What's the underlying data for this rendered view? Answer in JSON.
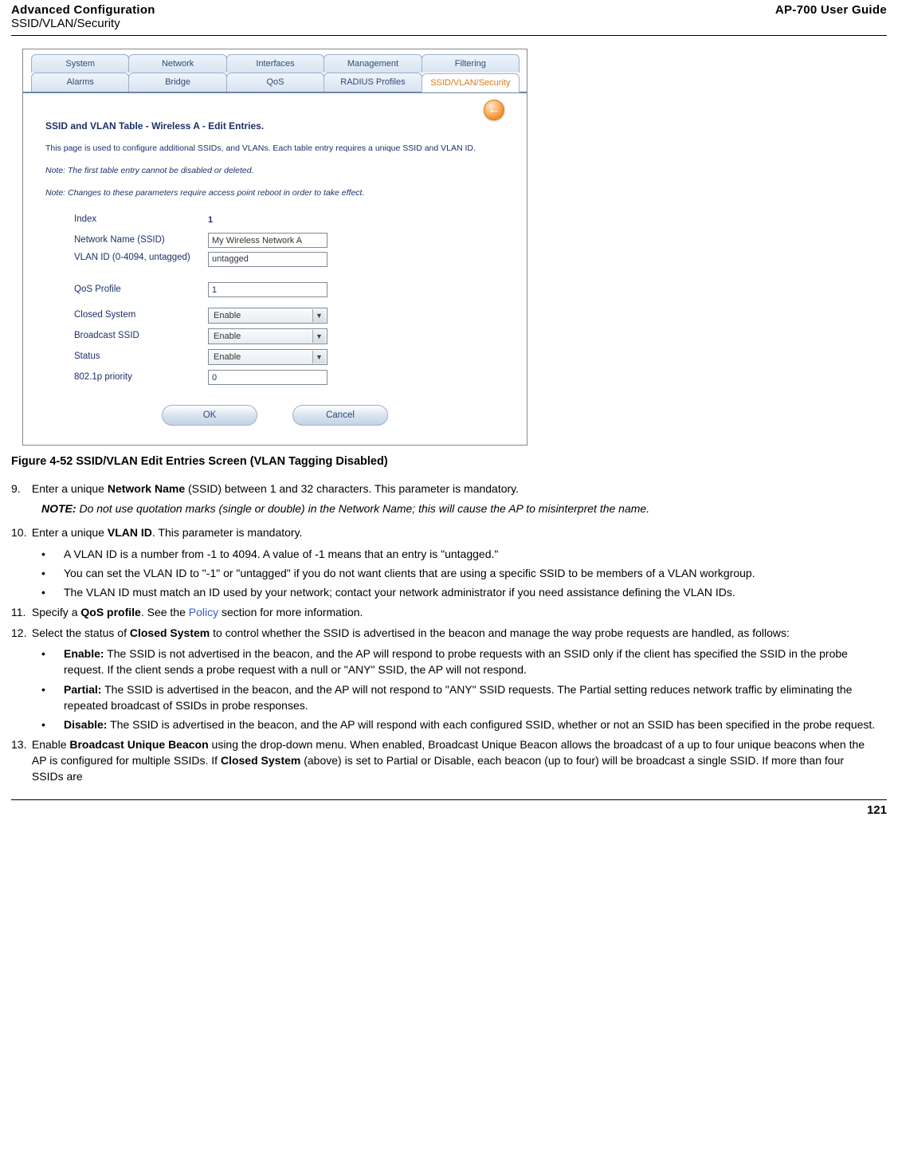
{
  "header": {
    "title": "Advanced Configuration",
    "subtitle": "SSID/VLAN/Security",
    "guide": "AP-700 User Guide"
  },
  "tabs_top": [
    "System",
    "Network",
    "Interfaces",
    "Management",
    "Filtering"
  ],
  "tabs_bottom": [
    "Alarms",
    "Bridge",
    "QoS",
    "RADIUS Profiles",
    "SSID/VLAN/Security"
  ],
  "back_arrow": "←",
  "shot": {
    "title": "SSID and VLAN Table - Wireless A - Edit Entries.",
    "desc": "This page is used to configure additional SSIDs, and VLANs. Each table entry requires a unique SSID and VLAN ID.",
    "note1": "Note: The first table entry cannot be disabled or deleted.",
    "note2": "Note: Changes to these parameters require access point reboot in order to take effect.",
    "fields": {
      "index_label": "Index",
      "index_value": "1",
      "ssid_label": "Network Name (SSID)",
      "ssid_value": "My Wireless Network A",
      "vlan_label": "VLAN ID (0-4094, untagged)",
      "vlan_value": "untagged",
      "qos_label": "QoS Profile",
      "qos_value": "1",
      "closed_label": "Closed System",
      "closed_value": "Enable",
      "bcast_label": "Broadcast SSID",
      "bcast_value": "Enable",
      "status_label": "Status",
      "status_value": "Enable",
      "priority_label": "802.1p priority",
      "priority_value": "0"
    },
    "buttons": {
      "ok": "OK",
      "cancel": "Cancel"
    }
  },
  "caption": "Figure 4-52 SSID/VLAN Edit Entries Screen (VLAN Tagging Disabled)",
  "text": {
    "s9_num": "9.",
    "s9": "Enter a unique ",
    "s9_b": "Network Name",
    "s9_rest": " (SSID) between 1 and 32 characters. This parameter is mandatory.",
    "note_label": "NOTE:",
    "note_body": " Do not use quotation marks (single or double) in the Network Name; this will cause the AP to misinterpret the name.",
    "s10_num": "10.",
    "s10_a": "Enter a unique ",
    "s10_b": "VLAN ID",
    "s10_c": ". This parameter is mandatory.",
    "s10_b1": "A VLAN ID is a number from -1 to 4094. A value of -1 means that an entry is \"untagged.\"",
    "s10_b2": "You can set the VLAN ID to \"-1\" or \"untagged\" if you do not want clients that are using a specific SSID to be members of a VLAN workgroup.",
    "s10_b3": "The VLAN ID must match an ID used by your network; contact your network administrator if you need assistance defining the VLAN IDs.",
    "s11_num": "11.",
    "s11_a": "Specify a ",
    "s11_b": "QoS profile",
    "s11_c": ". See the ",
    "s11_link": "Policy",
    "s11_d": " section for more information.",
    "s12_num": "12.",
    "s12_a": "Select the status of ",
    "s12_b": "Closed System",
    "s12_c": " to control whether the SSID is advertised in the beacon and manage the way probe requests are handled, as follows:",
    "s12_b1l": "Enable:",
    "s12_b1": " The SSID is not advertised in the beacon, and the AP will respond to probe requests with an SSID only if the client has specified the SSID in the probe request. If the client sends a probe request with a null or \"ANY\" SSID, the AP will not respond.",
    "s12_b2l": "Partial:",
    "s12_b2": " The SSID is advertised in the beacon, and the AP will not respond to \"ANY\" SSID requests. The Partial setting reduces network traffic by eliminating the repeated broadcast of SSIDs in probe responses.",
    "s12_b3l": "Disable:",
    "s12_b3": " The SSID is advertised in the beacon, and the AP will respond with each configured SSID, whether or not an SSID has been specified in the probe request.",
    "s13_num": "13.",
    "s13_a": "Enable ",
    "s13_b": "Broadcast Unique Beacon",
    "s13_c": " using the drop-down menu. When enabled, Broadcast Unique Beacon allows the broadcast of a up to four unique beacons when the AP is configured for multiple SSIDs. If ",
    "s13_d": "Closed System",
    "s13_e": " (above) is set to Partial or Disable, each beacon (up to four) will be broadcast a single SSID. If more than four SSIDs are"
  },
  "page_number": "121",
  "bullet": "•",
  "caret": "▼"
}
